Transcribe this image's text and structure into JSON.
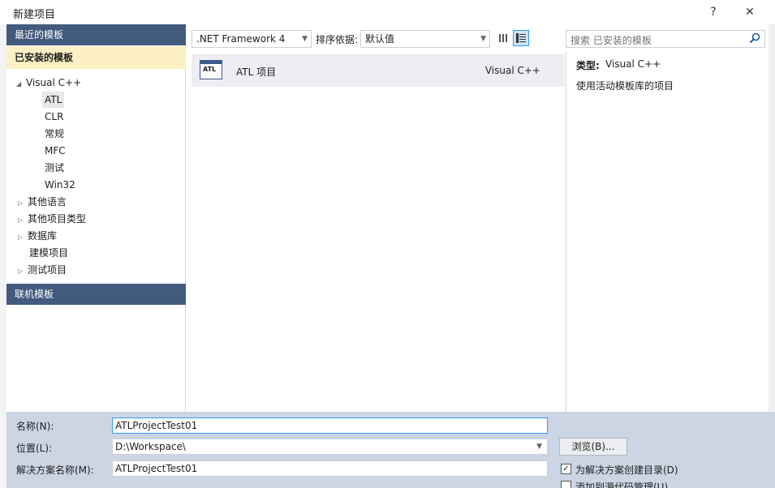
{
  "window": {
    "title": "新建项目",
    "help_glyph": "?",
    "close_glyph": "✕"
  },
  "sidebar": {
    "recent_label": "最近的模板",
    "installed_label": "已安装的模板",
    "online_label": "联机模板",
    "tree": [
      {
        "label": "Visual C++",
        "expanded": true
      },
      {
        "label": "ATL",
        "selected": true
      },
      {
        "label": "CLR"
      },
      {
        "label": "常规"
      },
      {
        "label": "MFC"
      },
      {
        "label": "测试"
      },
      {
        "label": "Win32"
      },
      {
        "label": "其他语言"
      },
      {
        "label": "其他项目类型"
      },
      {
        "label": "数据库"
      },
      {
        "label": "建模项目"
      },
      {
        "label": "测试项目"
      }
    ]
  },
  "toolbar": {
    "framework": ".NET Framework 4",
    "sort_label": "排序依据:",
    "sort_value": "默认值",
    "search_placeholder": "搜索 已安装的模板"
  },
  "templates": [
    {
      "icon_text": "ATL",
      "name": "ATL 项目",
      "language": "Visual C++"
    }
  ],
  "details": {
    "type_label": "类型:",
    "type_value": "Visual C++",
    "description": "使用活动模板库的项目"
  },
  "form": {
    "name_label": "名称(N):",
    "name_value": "ATLProjectTest01",
    "location_label": "位置(L):",
    "location_value": "D:\\Workspace\\",
    "solution_label": "解决方案名称(M):",
    "solution_value": "ATLProjectTest01",
    "browse_label": "浏览(B)...",
    "create_dir_label": "为解决方案创建目录(D)",
    "create_dir_checked": true,
    "source_control_label": "添加到源代码管理(U)",
    "source_control_checked": false
  },
  "colors": {
    "section_header": "#425a7e",
    "selected_section": "#fdf0c4",
    "form_background": "#ccd5e4"
  }
}
